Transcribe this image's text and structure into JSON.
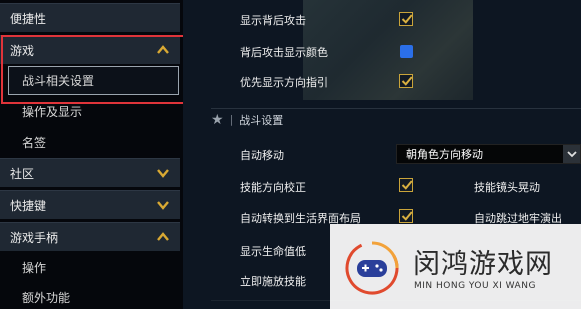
{
  "sidebar": {
    "items": [
      {
        "label": "便捷性"
      },
      {
        "label": "游戏"
      },
      {
        "label": "战斗相关设置"
      },
      {
        "label": "操作及显示"
      },
      {
        "label": "名签"
      },
      {
        "label": "社区"
      },
      {
        "label": "快捷键"
      },
      {
        "label": "游戏手柄"
      },
      {
        "label": "操作"
      },
      {
        "label": "额外功能"
      }
    ]
  },
  "settings": {
    "show_back_attack": "显示背后攻击",
    "back_attack_color": "背后攻击显示颜色",
    "direction_guide_first": "优先显示方向指引",
    "section_combat": "战斗设置",
    "auto_move": "自动移动",
    "auto_move_value": "朝角色方向移动",
    "skill_direction_fix": "技能方向校正",
    "skill_camera_shake": "技能镜头晃动",
    "auto_switch_life_ui": "自动转换到生活界面布局",
    "auto_skip_dungeon_cutscene": "自动跳过地牢演出",
    "show_hp_value": "显示生命值低",
    "instant_cast": "立即施放技能"
  },
  "colors": {
    "accent_gold": "#c9a43a",
    "swatch_blue": "#2b6fe8",
    "highlight_red": "#e0343a"
  },
  "watermark": {
    "title": "闵鸿游戏网",
    "subtitle": "MIN HONG YOU XI WANG"
  }
}
